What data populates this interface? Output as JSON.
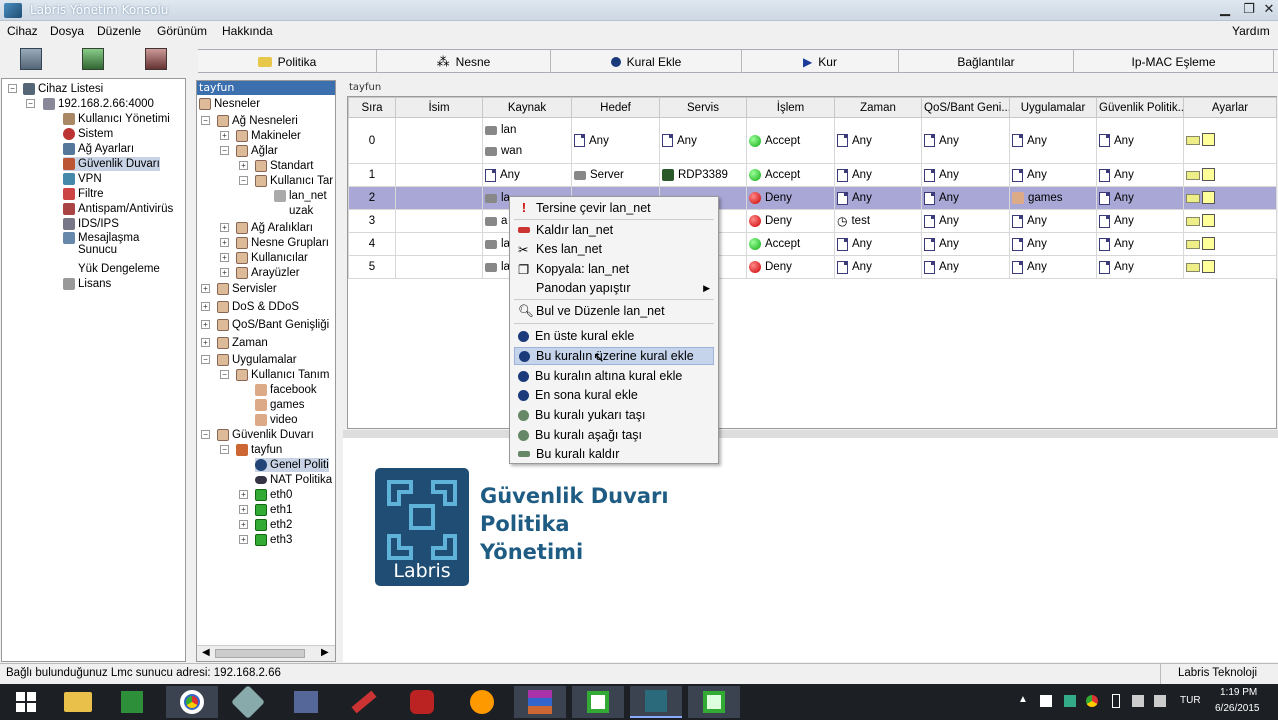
{
  "window": {
    "title": "Labris Yönetim Konsolu",
    "btn_min": "▁",
    "btn_max": "❐",
    "btn_close": "✕"
  },
  "menu": {
    "items": [
      "Cihaz",
      "Dosya",
      "Düzenle",
      "Görünüm",
      "Hakkında"
    ],
    "right": "Yardım"
  },
  "tabs": [
    "Politika",
    "Nesne",
    "Kural Ekle",
    "Kur",
    "Bağlantılar",
    "Ip-MAC Eşleme"
  ],
  "left_tree": {
    "root": "Cihaz Listesi",
    "host": "192.168.2.66:4000",
    "items": [
      "Kullanıcı Yönetimi",
      "Sistem",
      "Ağ Ayarları",
      "Güvenlik Duvarı",
      "VPN",
      "Filtre",
      "Antispam/Antivirüs",
      "IDS/IPS",
      "Mesajlaşma Sunucu",
      "Yük Dengeleme",
      "Lisans"
    ]
  },
  "mid_tree": {
    "header": "tayfun",
    "nodes": [
      "Nesneler",
      "Ağ Nesneleri",
      "Makineler",
      "Ağlar",
      "Standart",
      "Kullanıcı Tar",
      "lan_net",
      "uzak",
      "Ağ Aralıkları",
      "Nesne Grupları",
      "Kullanıcılar",
      "Arayüzler",
      "Servisler",
      "DoS & DDoS",
      "QoS/Bant Genişliği",
      "Zaman",
      "Uygulamalar",
      "Kullanıcı Tanım",
      "facebook",
      "games",
      "video",
      "Güvenlik Duvarı",
      "tayfun",
      "Genel Politi",
      "NAT Politika",
      "eth0",
      "eth1",
      "eth2",
      "eth3"
    ]
  },
  "grid": {
    "title": "tayfun",
    "columns": [
      "Sıra",
      "İsim",
      "Kaynak",
      "Hedef",
      "Servis",
      "İşlem",
      "Zaman",
      "QoS/Bant Geni...",
      "Uygulamalar",
      "Güvenlik Politik...",
      "Ayarlar"
    ],
    "rows": [
      {
        "sira": "0",
        "kaynak": [
          "lan",
          "wan"
        ],
        "hedef": "Any",
        "servis": "Any",
        "islem": "Accept",
        "zaman": "Any",
        "qos": "Any",
        "uyg": "Any",
        "gp": "Any"
      },
      {
        "sira": "1",
        "kaynak": [
          "Any"
        ],
        "hedef": "Server",
        "servis": "RDP3389",
        "islem": "Accept",
        "zaman": "Any",
        "qos": "Any",
        "uyg": "Any",
        "gp": "Any"
      },
      {
        "sira": "2",
        "kaynak": [
          "la"
        ],
        "hedef": "",
        "servis": "",
        "islem": "Deny",
        "zaman": "Any",
        "qos": "Any",
        "uyg": "games",
        "gp": "Any"
      },
      {
        "sira": "3",
        "kaynak": [
          "a"
        ],
        "hedef": "",
        "servis": "",
        "islem": "Deny",
        "zaman": "test",
        "qos": "Any",
        "uyg": "Any",
        "gp": "Any"
      },
      {
        "sira": "4",
        "kaynak": [
          "la"
        ],
        "hedef": "",
        "servis": "",
        "islem": "Accept",
        "zaman": "Any",
        "qos": "Any",
        "uyg": "Any",
        "gp": "Any"
      },
      {
        "sira": "5",
        "kaynak": [
          "la"
        ],
        "hedef": "",
        "servis": "",
        "islem": "Deny",
        "zaman": "Any",
        "qos": "Any",
        "uyg": "Any",
        "gp": "Any"
      }
    ]
  },
  "context_menu": [
    "Tersine çevir lan_net",
    "Kaldır lan_net",
    "Kes lan_net",
    "Kopyala: lan_net",
    "Panodan yapıştır",
    "Bul ve Düzenle lan_net",
    "En üste kural ekle",
    "Bu kuralın üzerine kural ekle",
    "Bu kuralın altına kural ekle",
    "En sona kural ekle",
    "Bu kuralı yukarı taşı",
    "Bu kuralı aşağı taşı",
    "Bu kuralı kaldır"
  ],
  "brand": {
    "line1": "Güvenlik Duvarı",
    "line2": "Politika",
    "line3": "Yönetimi",
    "logo_text": "Labris"
  },
  "status": {
    "left": "Bağlı bulunduğunuz Lmc sunucu adresi: 192.168.2.66",
    "right": "Labris Teknoloji"
  },
  "taskbar": {
    "lang": "TUR",
    "time": "1:19 PM",
    "date": "6/26/2015"
  },
  "colors": {
    "selected_row": "#a9a7d5",
    "accent": "#1f5c83"
  }
}
